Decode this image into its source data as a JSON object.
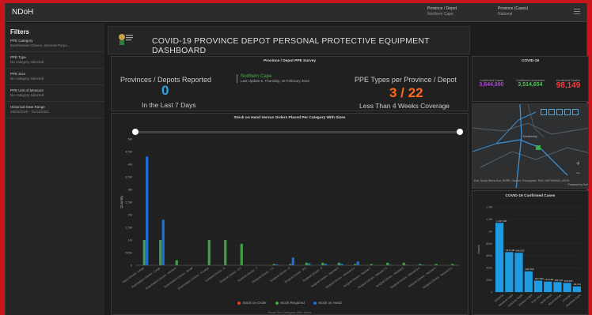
{
  "app": {
    "title": "NDoH"
  },
  "header": {
    "province_label": "Province / Depot",
    "province_value": "Northern Cape",
    "cases_label": "Province (Cases)",
    "cases_value": "National"
  },
  "filters": {
    "heading": "Filters",
    "items": [
      {
        "name": "PPE Category",
        "value": "Examination Gloves, General Purpo..."
      },
      {
        "name": "PPE Type",
        "value": "No category selected"
      },
      {
        "name": "PPE Size",
        "value": "No category selected"
      },
      {
        "name": "PPE Unit of Measure",
        "value": "No category selected"
      },
      {
        "name": "Historical Date Range",
        "value": "28/04/2020 - 31/12/2021"
      }
    ]
  },
  "banner": {
    "title": "COVID-19 PROVINCE DEPOT PERSONAL PROTECTIVE EQUIPMENT DASHBOARD"
  },
  "survey": {
    "title": "Province / Depot PPE Survey",
    "reported_label": "Provinces / Depots Reported",
    "reported_value": "0",
    "reported_sub": "In the Last 7 Days",
    "depot_name": "Northern Cape",
    "last_update": "Last Update 5, Thursday, 10 February 2022",
    "types_label": "PPE Types per Province / Depot",
    "types_value": "3 / 22",
    "types_sub": "Less Than 4 Weeks Coverage"
  },
  "covid": {
    "title": "COVID-19",
    "confirmed_label": "Confirmed Cases",
    "confirmed_value": "3,644,990",
    "recovered_label": "Confirmed recoveries",
    "recovered_value": "3,514,654",
    "deaths_label": "Confirmed Deaths",
    "deaths_value": "98,149",
    "colors": {
      "confirmed": "#b040e0",
      "recovered": "#52c15a",
      "deaths": "#ff3a3a"
    }
  },
  "map": {
    "attribution": "Esri, South Africa Esri, HERE, Garmin, Foursquare, FAO, METI/NASA, USGS",
    "powered": "Powered by Esri",
    "place_label": "Kimberley",
    "zoom_in": "+",
    "zoom_out": "−"
  },
  "main_chart": {
    "title": "Stock on Hand Versus Orders Placed Per Category With Sizes",
    "x_caption": "Stock Per Category With Sizes",
    "legend": [
      "Stock on Order",
      "Stock Required",
      "Stock on Hand"
    ]
  },
  "chart_data": [
    {
      "type": "bar",
      "title": "Stock on Hand Versus Orders Placed Per Category With Sizes",
      "xlabel": "Stock Per Category With Sizes",
      "ylabel": "Quantity",
      "ylim": [
        0,
        4500000
      ],
      "y_ticks": [
        "0",
        "500k",
        "1M",
        "1.5M",
        "2M",
        "2.5M",
        "3M",
        "3.5M",
        "4M",
        "4.5M",
        "5M"
      ],
      "categories": [
        "Aqua Gloves - Large",
        "Examination Gloves - Large",
        "Examination Gloves - Medium",
        "Examination Gloves - Small",
        "Examination Gloves - X-Large",
        "Surgical Gloves - 6",
        "Surgical Gloves - 6.5",
        "Surgical Gloves - 7",
        "Surgical Gloves - 7.5",
        "Surgical Gloves - 8",
        "Surgical Gloves - 8.5",
        "Surgical Gloves - 9",
        "Surgical Gloves - Neutral 6",
        "Surgical Gloves - Neutral 6.5",
        "Surgical Gloves - Neutral 7",
        "Surgical Gloves - Neutral 7.5",
        "Surgical Gloves - Neutral 8",
        "Surgical Gloves - Neutral 8.5",
        "Surgical Gloves - Neutral 9",
        "Surgical Gloves - Neutral 9.5"
      ],
      "series": [
        {
          "name": "Stock on Order",
          "color": "#e53935",
          "values": [
            0,
            0,
            0,
            0,
            0,
            0,
            0,
            0,
            0,
            0,
            0,
            0,
            0,
            0,
            0,
            0,
            0,
            0,
            0,
            0
          ]
        },
        {
          "name": "Stock Required",
          "color": "#43a047",
          "values": [
            1000000,
            1000000,
            200000,
            0,
            1000000,
            1000000,
            850000,
            0,
            50000,
            50000,
            100000,
            100000,
            100000,
            50000,
            50000,
            100000,
            100000,
            50000,
            50000,
            50000
          ]
        },
        {
          "name": "Stock on Hand",
          "color": "#1e6fd9",
          "values": [
            4300000,
            1800000,
            0,
            0,
            0,
            0,
            0,
            0,
            30000,
            300000,
            80000,
            60000,
            60000,
            150000,
            0,
            20000,
            20000,
            20000,
            0,
            0
          ]
        }
      ]
    },
    {
      "type": "bar",
      "title": "COVID-19 Confirmed Cases",
      "ylabel": "Cases",
      "ylim": [
        0,
        1400000
      ],
      "y_ticks": [
        "0",
        "200k",
        "400k",
        "600k",
        "800k",
        "1M",
        "1.2M",
        "1.4M"
      ],
      "categories": [
        "Gauteng",
        "Western Cape",
        "KwaZulu-Natal",
        "Eastern Cape",
        "Free State",
        "North West",
        "Mpumalanga",
        "Limpopo",
        "Northern Cape"
      ],
      "series": [
        {
          "name": "Confirmed Cases",
          "color": "#1e9be0",
          "values": [
            1137000,
            657000,
            646000,
            342000,
            188000,
            172000,
            165000,
            150000,
            94000
          ]
        }
      ],
      "data_labels": [
        "1,137,100",
        "657,108",
        "646,033",
        "342,159",
        "187,690",
        "172,148",
        "165,119",
        "150,065",
        "94,123"
      ]
    }
  ]
}
